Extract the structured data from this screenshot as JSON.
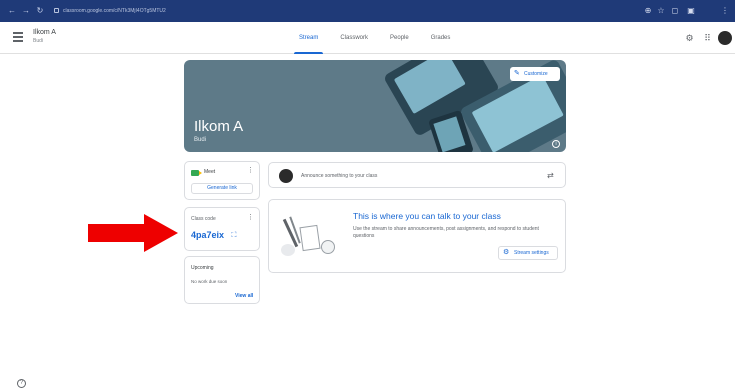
{
  "browser": {
    "back": "←",
    "forward": "→",
    "reload": "↻",
    "url": "classroom.google.com/c/NTk3MjI4OTg5MTU2",
    "extensions": [
      "⊕",
      "☆",
      "◻",
      "▣",
      "⋮"
    ]
  },
  "header": {
    "class_name": "Ilkom A",
    "section": "Budi",
    "tabs": [
      "Stream",
      "Classwork",
      "People",
      "Grades"
    ],
    "active_tab": "Stream",
    "settings_icon": "gear-icon",
    "apps_icon": "apps-icon"
  },
  "banner": {
    "customize_label": "Customize",
    "title": "Ilkom A",
    "subtitle": "Budi"
  },
  "meet": {
    "label": "Meet",
    "generate_link": "Generate link"
  },
  "class_code": {
    "label": "Class code",
    "value": "4pa7eix"
  },
  "upcoming": {
    "title": "Upcoming",
    "text": "No work due soon",
    "view_all": "View all"
  },
  "announce": {
    "placeholder": "Announce something to your class"
  },
  "stream_info": {
    "title": "This is where you can talk to your class",
    "description": "Use the stream to share announcements, post assignments, and respond to student questions",
    "settings_button": "Stream settings"
  },
  "colors": {
    "accent": "#1967d2",
    "banner": "#5e7a88",
    "browser_bar": "#1f3a78",
    "arrow": "#ee0000"
  }
}
